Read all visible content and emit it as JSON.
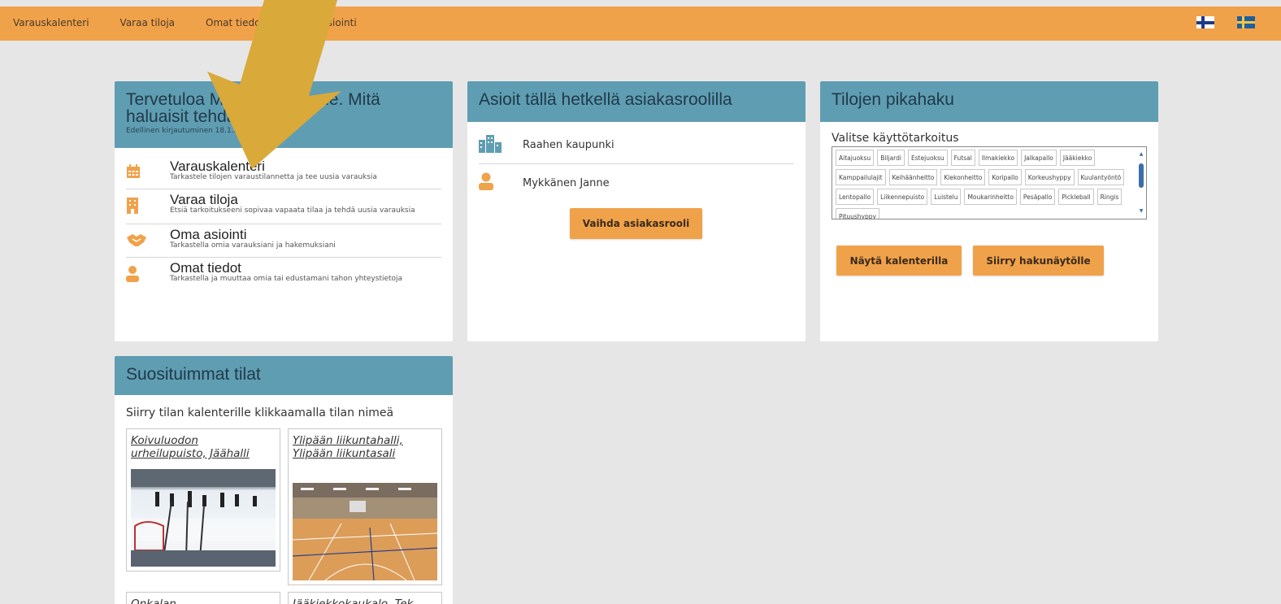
{
  "nav": {
    "items": [
      "Varauskalenteri",
      "Varaa tiloja",
      "Omat tiedot",
      "Oma asiointi"
    ],
    "languages": [
      "fi-flag",
      "sv-flag"
    ]
  },
  "welcome": {
    "title": "Tervetuloa Mykkänen Janne. Mitä haluaisit tehdä tänään?",
    "last_login": "Edellinen kirjautuminen 18.1.2023 klo 15:03",
    "items": [
      {
        "icon": "calendar-icon",
        "title": "Varauskalenteri",
        "desc": "Tarkastele tilojen varaustilannetta ja tee uusia varauksia"
      },
      {
        "icon": "building-icon",
        "title": "Varaa tiloja",
        "desc": "Etsiä tarkoitukseeni sopivaa vapaata tilaa ja tehdä uusia varauksia"
      },
      {
        "icon": "handshake-icon",
        "title": "Oma asiointi",
        "desc": "Tarkastella omia varauksiani ja hakemuksiani"
      },
      {
        "icon": "user-icon",
        "title": "Omat tiedot",
        "desc": "Tarkastella ja muuttaa omia tai edustamani tahon yhteystietoja"
      }
    ]
  },
  "role": {
    "title": "Asioit tällä hetkellä asiakasroolilla",
    "items": [
      {
        "icon": "city-icon",
        "label": "Raahen kaupunki"
      },
      {
        "icon": "user-icon",
        "label": "Mykkänen Janne"
      }
    ],
    "button": "Vaihda asiakasrooli"
  },
  "search": {
    "title": "Tilojen pikahaku",
    "label": "Valitse käyttötarkoitus",
    "tags": [
      "Aitajuoksu",
      "Biljardi",
      "Estejuoksu",
      "Futsal",
      "Ilmakiekko",
      "Jalkapallo",
      "Jääkiekko",
      "Kamppailulajit",
      "Keihäänheitto",
      "Kiekonheitto",
      "Koripallo",
      "Korkeushyppy",
      "Kuulantyöntö",
      "Lentopallo",
      "Liikennepuisto",
      "Luistelu",
      "Moukarinheitto",
      "Pesäpallo",
      "Pickleball",
      "Ringis",
      "Pituushyppy"
    ],
    "btn_calendar": "Näytä kalenterilla",
    "btn_search": "Siirry hakunäytölle"
  },
  "popular": {
    "title": "Suosituimmat tilat",
    "hint": "Siirry tilan kalenterille klikkaamalla tilan nimeä",
    "tiles": [
      "Koivuluodon urheilupuisto, Jäähalli",
      "Ylipään liikuntahalli, Ylipään liikuntasali",
      "Onkalan",
      "Jääkiekkokaukalo, Tek"
    ]
  }
}
